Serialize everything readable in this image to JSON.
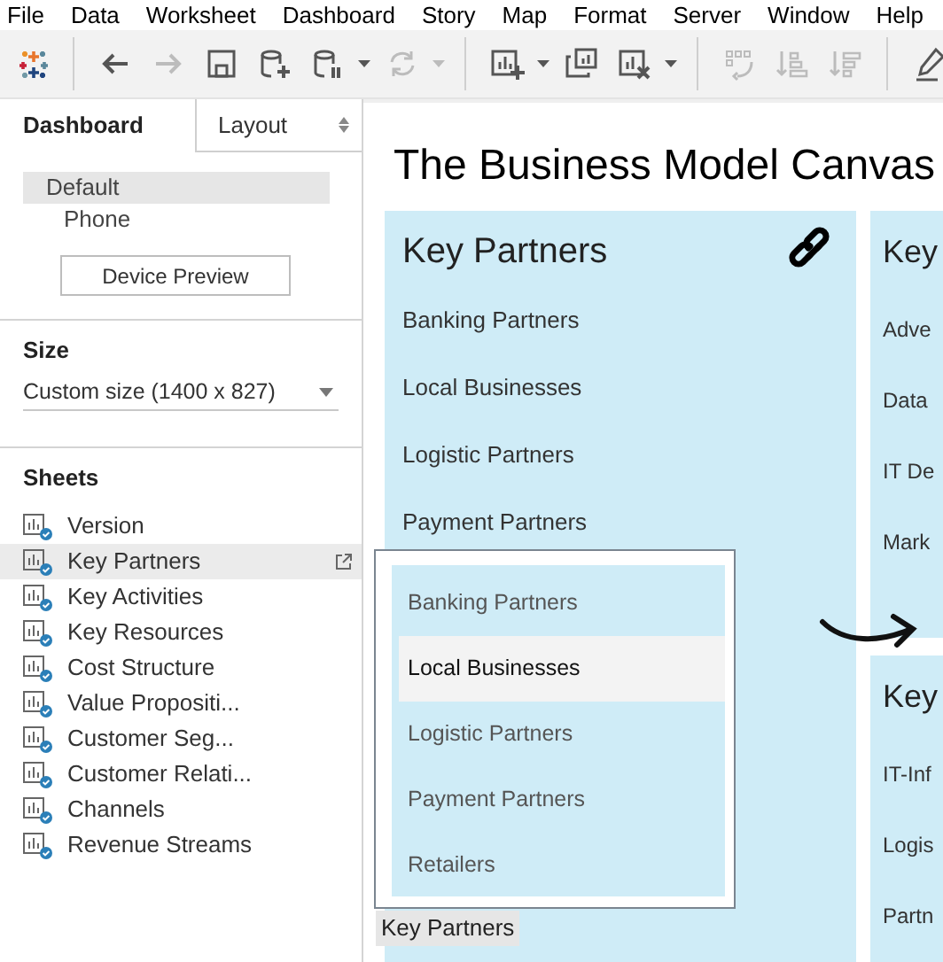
{
  "menu_bar": [
    "File",
    "Data",
    "Worksheet",
    "Dashboard",
    "Story",
    "Map",
    "Format",
    "Server",
    "Window",
    "Help"
  ],
  "toolbar": [
    [
      {
        "disabled": false,
        "dropdown": false
      },
      {
        "disabled": true,
        "dropdown": false
      },
      {
        "disabled": false,
        "dropdown": false
      },
      {
        "disabled": false,
        "dropdown": false
      },
      {
        "disabled": false,
        "dropdown": true
      },
      {
        "disabled": true,
        "dropdown": true
      }
    ],
    [
      {
        "disabled": false,
        "dropdown": true
      },
      {
        "disabled": false,
        "dropdown": false
      },
      {
        "disabled": false,
        "dropdown": true
      }
    ],
    [
      {
        "disabled": true,
        "dropdown": false
      },
      {
        "disabled": true,
        "dropdown": false
      },
      {
        "disabled": true,
        "dropdown": false
      }
    ],
    [
      {
        "disabled": false,
        "dropdown": false
      }
    ]
  ],
  "side_tabs": [
    {
      "label": "Dashboard",
      "selected": true
    },
    {
      "label": "Layout",
      "selected": false
    }
  ],
  "devices": [
    {
      "label": "Default",
      "selected": true
    },
    {
      "label": "Phone",
      "selected": false
    }
  ],
  "device_preview_button": "Device Preview",
  "size": {
    "heading": "Size",
    "value": "Custom size (1400 x 827)"
  },
  "sheets": {
    "heading": "Sheets",
    "items": [
      {
        "label": "Version",
        "selected": false
      },
      {
        "label": "Key Partners",
        "selected": true
      },
      {
        "label": "Key Activities",
        "selected": false
      },
      {
        "label": "Key Resources",
        "selected": false
      },
      {
        "label": "Cost Structure",
        "selected": false
      },
      {
        "label": "Value Propositi...",
        "selected": false
      },
      {
        "label": "Customer Seg...",
        "selected": false
      },
      {
        "label": "Customer Relati...",
        "selected": false
      },
      {
        "label": "Channels",
        "selected": false
      },
      {
        "label": "Revenue Streams",
        "selected": false
      }
    ]
  },
  "dashboard": {
    "title": "The Business Model Canvas",
    "panels": [
      {
        "title": "Key Partners",
        "linked": true,
        "items": [
          "Banking Partners",
          "Local Businesses",
          "Logistic Partners",
          "Payment Partners"
        ]
      },
      {
        "title": "Key",
        "linked": false,
        "items": [
          "Adve",
          "Data",
          "IT De",
          "Mark"
        ]
      },
      {
        "title": "Key",
        "linked": false,
        "items": [
          "IT-Inf",
          "Logis",
          "Partn"
        ]
      }
    ]
  },
  "popup": {
    "items": [
      {
        "label": "Banking Partners",
        "selected": false
      },
      {
        "label": "Local Businesses",
        "selected": true
      },
      {
        "label": "Logistic Partners",
        "selected": false
      },
      {
        "label": "Payment Partners",
        "selected": false
      },
      {
        "label": "Retailers",
        "selected": false
      }
    ],
    "tooltip": "Key Partners"
  }
}
